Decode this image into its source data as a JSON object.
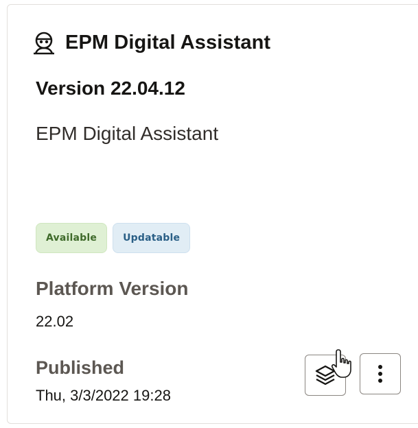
{
  "card": {
    "icon": "digital-assistant-bot-icon",
    "title": "EPM Digital Assistant",
    "version": "Version 22.04.12",
    "description": "EPM Digital Assistant",
    "badges": [
      {
        "label": "Available",
        "color": "#3f6a2a",
        "background": "#dff0d4"
      },
      {
        "label": "Updatable",
        "color": "#2a5f86",
        "background": "#e1edf5"
      }
    ],
    "platform_version": {
      "label": "Platform Version",
      "value": "22.02"
    },
    "published": {
      "label": "Published",
      "value": "Thu, 3/3/2022 19:28"
    },
    "actions": {
      "layers_icon": "layers-icon",
      "more_icon": "more-vertical-icon"
    }
  }
}
